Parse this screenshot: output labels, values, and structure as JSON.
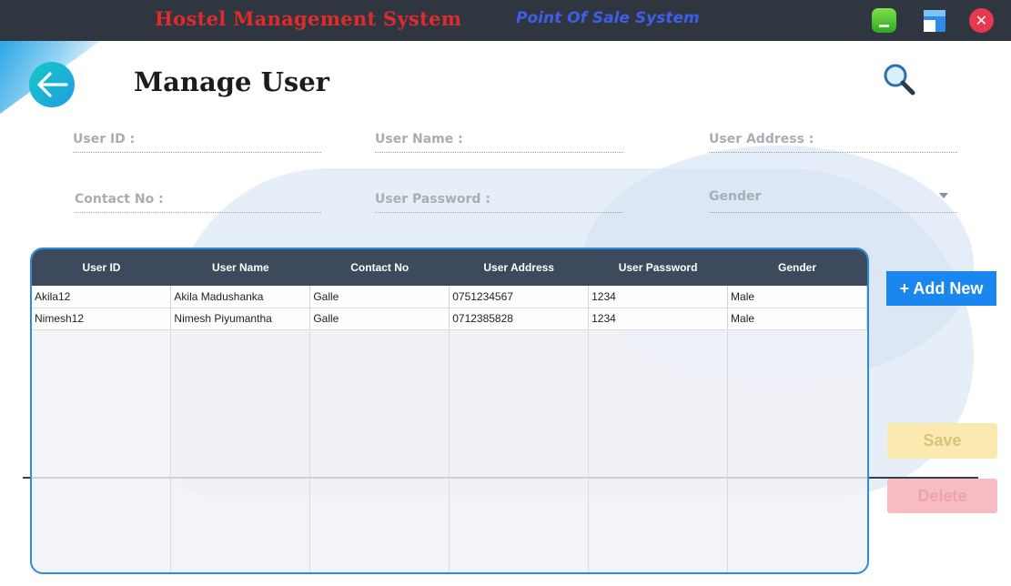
{
  "titlebar": {
    "app_title": "Hostel Management System",
    "pos_title": "Point Of Sale System",
    "minimize_icon": "minimize-icon",
    "maximize_icon": "maximize-icon",
    "close_icon": "close-icon",
    "close_glyph": "✕"
  },
  "header": {
    "title": "Manage User",
    "back_icon": "arrow-left-icon",
    "search_icon": "search-icon"
  },
  "form": {
    "user_id_placeholder": "User ID :",
    "user_name_placeholder": "User Name :",
    "user_address_placeholder": "User Address :",
    "contact_no_placeholder": "Contact No :",
    "user_password_placeholder": "User Password :",
    "gender_value": "Gender"
  },
  "table": {
    "columns": [
      "User ID",
      "User Name",
      "Contact No",
      "User Address",
      "User Password",
      "Gender"
    ],
    "rows": [
      [
        "Akila12",
        "Akila Madushanka",
        "Galle",
        "0751234567",
        "1234",
        "Male"
      ],
      [
        "Nimesh12",
        "Nimesh Piyumantha",
        "Galle",
        "0712385828",
        "1234",
        "Male"
      ]
    ]
  },
  "actions": {
    "add_new_label": "+ Add New",
    "save_label": "Save",
    "delete_label": "Delete"
  },
  "colors": {
    "titlebar_bg": "#2f3640",
    "app_title": "#e02b2b",
    "pos_title": "#3e5ee8",
    "table_header": "#3d4a5c",
    "accent_blue": "#1a86f0"
  }
}
